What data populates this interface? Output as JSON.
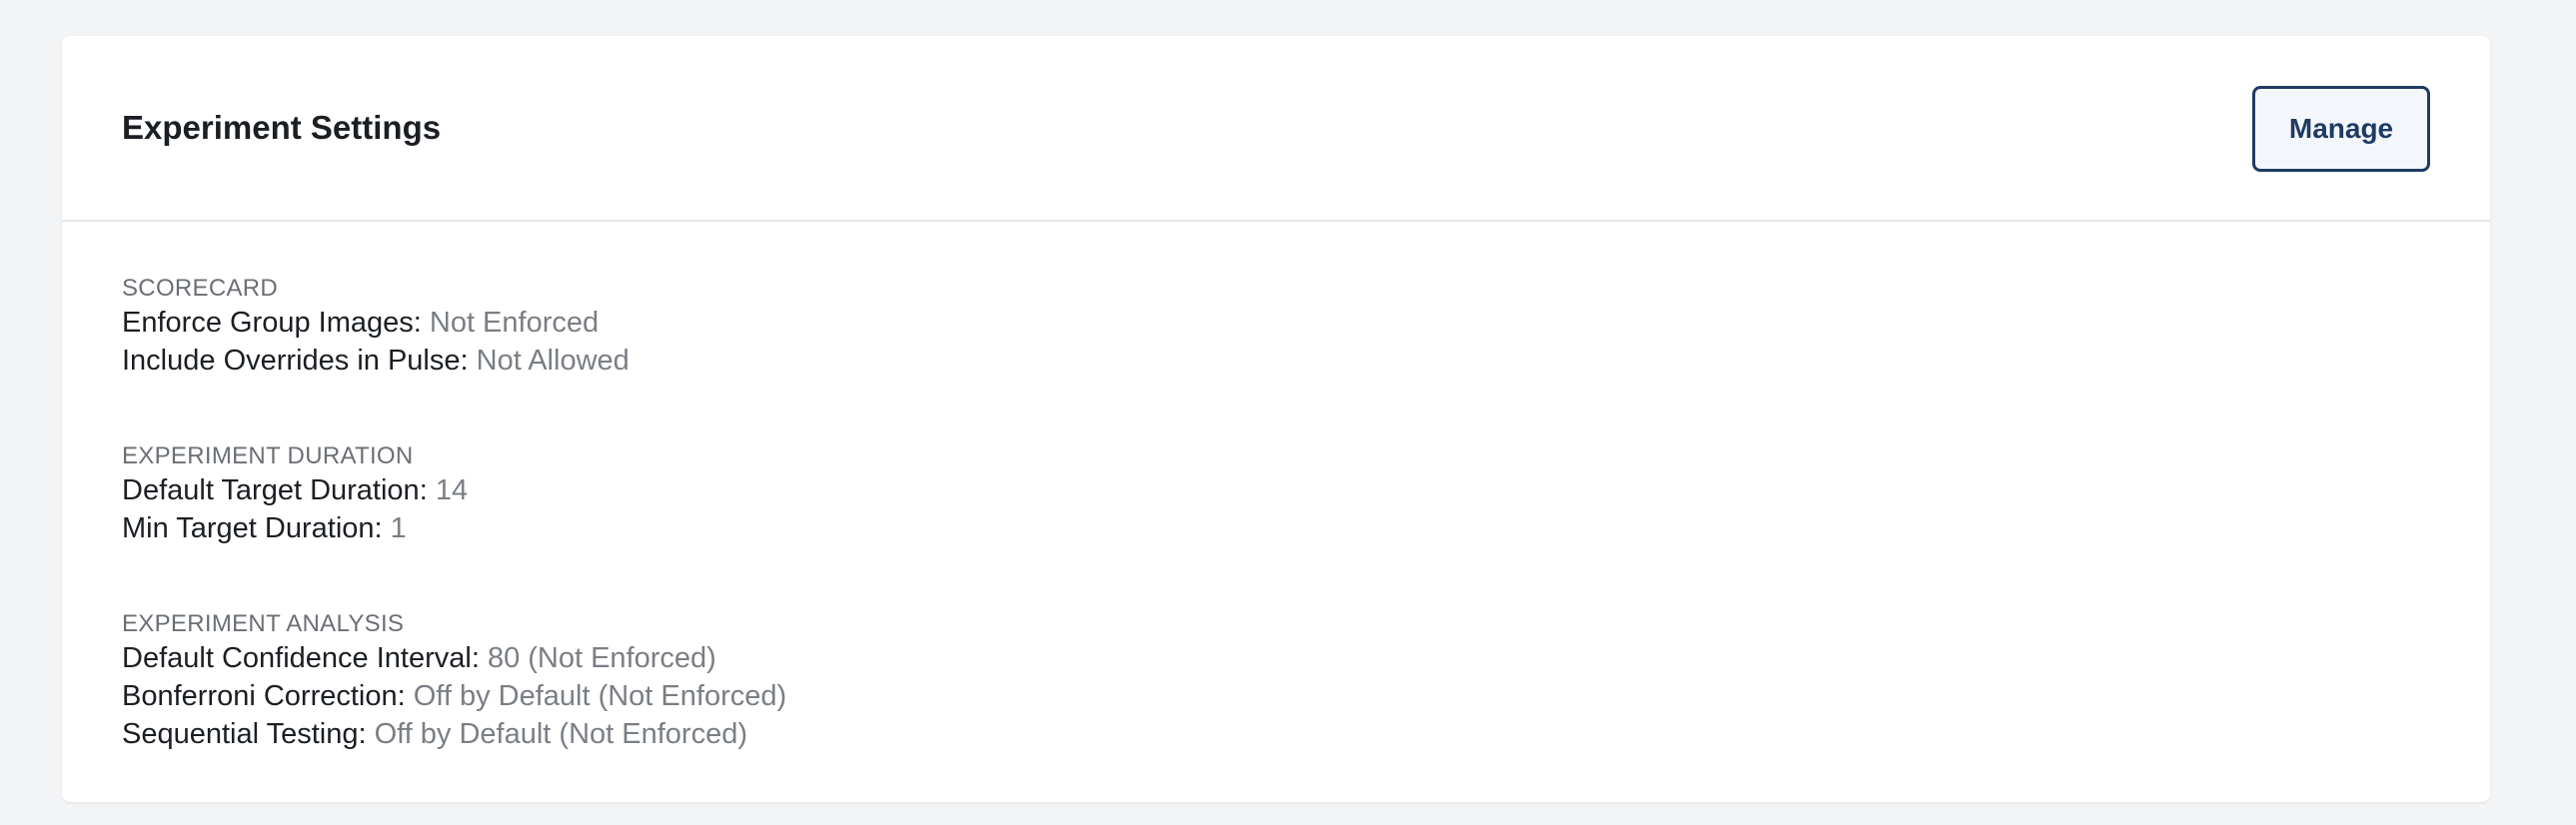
{
  "card": {
    "title": "Experiment Settings",
    "manage_label": "Manage"
  },
  "sections": [
    {
      "label": "SCORECARD",
      "rows": [
        {
          "key": "Enforce Group Images:",
          "value": "Not Enforced"
        },
        {
          "key": "Include Overrides in Pulse:",
          "value": "Not Allowed"
        }
      ]
    },
    {
      "label": "EXPERIMENT DURATION",
      "rows": [
        {
          "key": "Default Target Duration:",
          "value": "14"
        },
        {
          "key": "Min Target Duration:",
          "value": "1"
        }
      ]
    },
    {
      "label": "EXPERIMENT ANALYSIS",
      "rows": [
        {
          "key": "Default Confidence Interval:",
          "value": "80 (Not Enforced)"
        },
        {
          "key": "Bonferroni Correction:",
          "value": "Off by Default (Not Enforced)"
        },
        {
          "key": "Sequential Testing:",
          "value": "Off by Default (Not Enforced)"
        }
      ]
    }
  ]
}
